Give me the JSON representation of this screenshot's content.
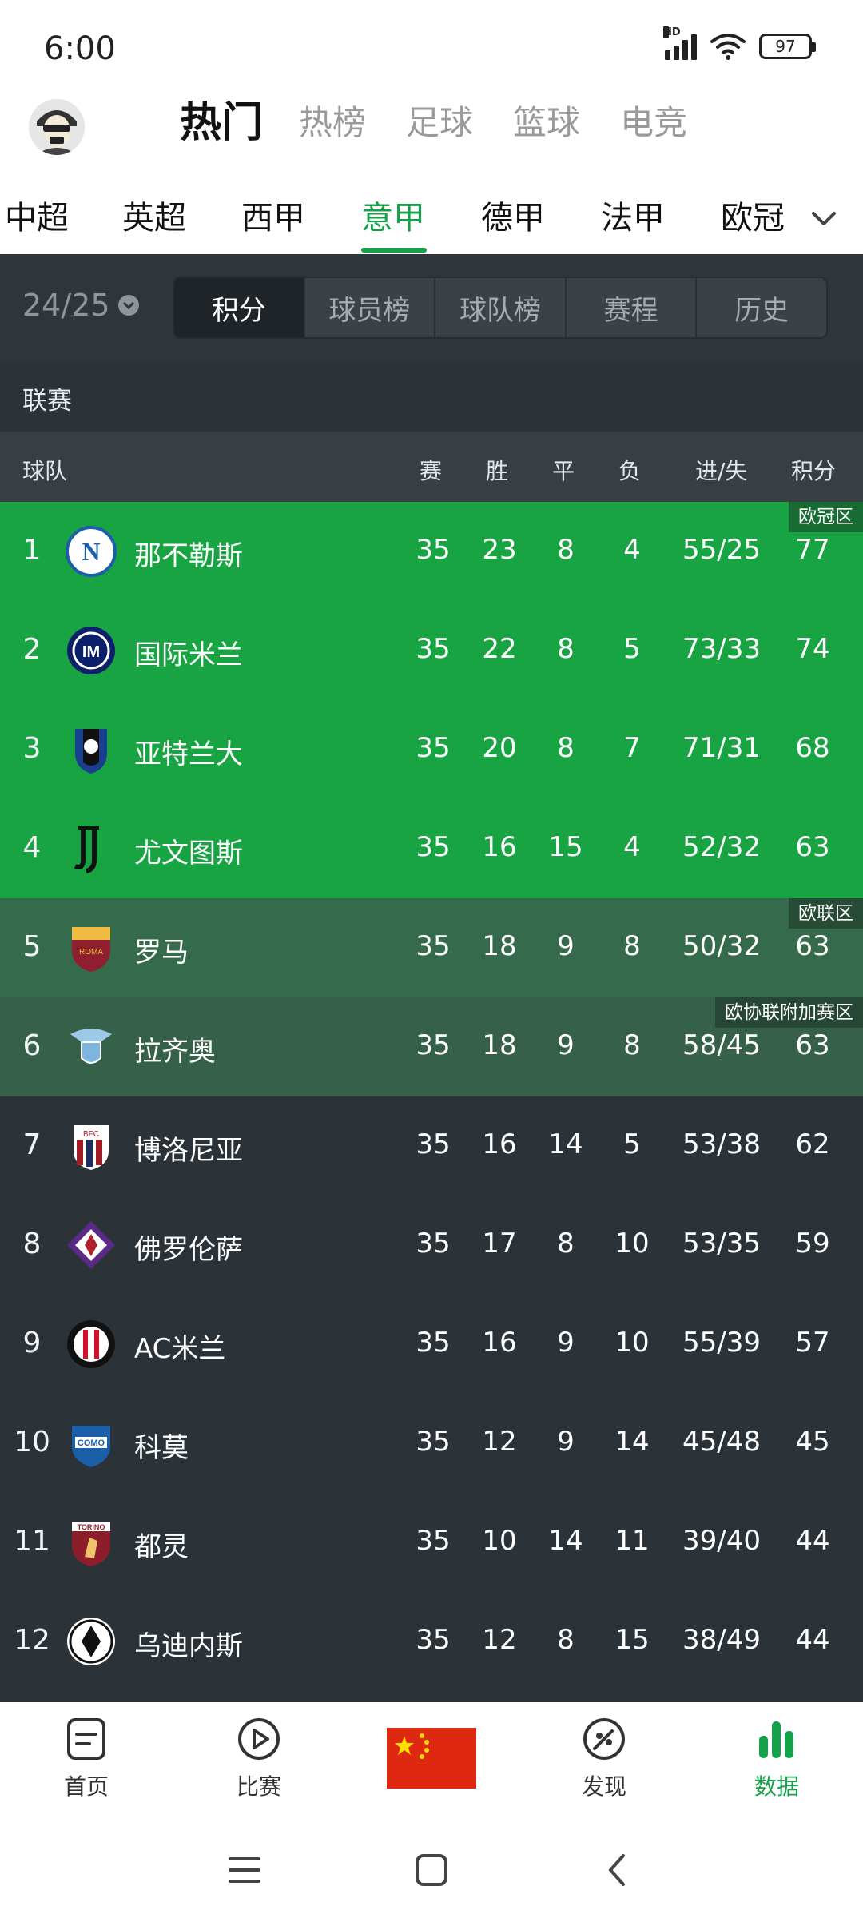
{
  "status": {
    "time": "6:00",
    "hd": "HD",
    "battery": "97"
  },
  "header": {
    "tabs": [
      "热门",
      "热榜",
      "足球",
      "篮球",
      "电竞"
    ]
  },
  "leagues": [
    "中超",
    "英超",
    "西甲",
    "意甲",
    "德甲",
    "法甲",
    "欧冠"
  ],
  "active_league": "意甲",
  "controls": {
    "season": "24/25",
    "segments": [
      "积分",
      "球员榜",
      "球队榜",
      "赛程",
      "历史"
    ],
    "active_segment": "积分"
  },
  "league_label": "联赛",
  "table": {
    "headers": {
      "team": "球队",
      "played": "赛",
      "win": "胜",
      "draw": "平",
      "loss": "负",
      "goals": "进/失",
      "points": "积分"
    },
    "rows": [
      {
        "rank": "1",
        "team": "那不勒斯",
        "played": "35",
        "win": "23",
        "draw": "8",
        "loss": "4",
        "goals": "55/25",
        "points": "77",
        "zone": "ucl",
        "tag": "欧冠区",
        "badge": "napoli"
      },
      {
        "rank": "2",
        "team": "国际米兰",
        "played": "35",
        "win": "22",
        "draw": "8",
        "loss": "5",
        "goals": "73/33",
        "points": "74",
        "zone": "ucl",
        "tag": "",
        "badge": "inter"
      },
      {
        "rank": "3",
        "team": "亚特兰大",
        "played": "35",
        "win": "20",
        "draw": "8",
        "loss": "7",
        "goals": "71/31",
        "points": "68",
        "zone": "ucl",
        "tag": "",
        "badge": "atalanta"
      },
      {
        "rank": "4",
        "team": "尤文图斯",
        "played": "35",
        "win": "16",
        "draw": "15",
        "loss": "4",
        "goals": "52/32",
        "points": "63",
        "zone": "ucl",
        "tag": "",
        "badge": "juventus"
      },
      {
        "rank": "5",
        "team": "罗马",
        "played": "35",
        "win": "18",
        "draw": "9",
        "loss": "8",
        "goals": "50/32",
        "points": "63",
        "zone": "uel",
        "tag": "欧联区",
        "badge": "roma"
      },
      {
        "rank": "6",
        "team": "拉齐奥",
        "played": "35",
        "win": "18",
        "draw": "9",
        "loss": "8",
        "goals": "58/45",
        "points": "63",
        "zone": "uecl",
        "tag": "欧协联附加赛区",
        "badge": "lazio"
      },
      {
        "rank": "7",
        "team": "博洛尼亚",
        "played": "35",
        "win": "16",
        "draw": "14",
        "loss": "5",
        "goals": "53/38",
        "points": "62",
        "zone": "none",
        "tag": "",
        "badge": "bologna"
      },
      {
        "rank": "8",
        "team": "佛罗伦萨",
        "played": "35",
        "win": "17",
        "draw": "8",
        "loss": "10",
        "goals": "53/35",
        "points": "59",
        "zone": "none",
        "tag": "",
        "badge": "fiorentina"
      },
      {
        "rank": "9",
        "team": "AC米兰",
        "played": "35",
        "win": "16",
        "draw": "9",
        "loss": "10",
        "goals": "55/39",
        "points": "57",
        "zone": "none",
        "tag": "",
        "badge": "milan"
      },
      {
        "rank": "10",
        "team": "科莫",
        "played": "35",
        "win": "12",
        "draw": "9",
        "loss": "14",
        "goals": "45/48",
        "points": "45",
        "zone": "none",
        "tag": "",
        "badge": "como"
      },
      {
        "rank": "11",
        "team": "都灵",
        "played": "35",
        "win": "10",
        "draw": "14",
        "loss": "11",
        "goals": "39/40",
        "points": "44",
        "zone": "none",
        "tag": "",
        "badge": "torino"
      },
      {
        "rank": "12",
        "team": "乌迪内斯",
        "played": "35",
        "win": "12",
        "draw": "8",
        "loss": "15",
        "goals": "38/49",
        "points": "44",
        "zone": "none",
        "tag": "",
        "badge": "udinese"
      }
    ]
  },
  "bottom_nav": [
    {
      "label": "首页",
      "icon": "home-icon"
    },
    {
      "label": "比赛",
      "icon": "play-icon"
    },
    {
      "label": "",
      "icon": "china-flag-icon"
    },
    {
      "label": "发现",
      "icon": "discover-icon"
    },
    {
      "label": "数据",
      "icon": "data-icon"
    }
  ],
  "colors": {
    "accent": "#15a14a",
    "ucl": "#19a443",
    "uel": "#366a4c",
    "uecl": "#36604a",
    "dark": "#2b3238"
  }
}
